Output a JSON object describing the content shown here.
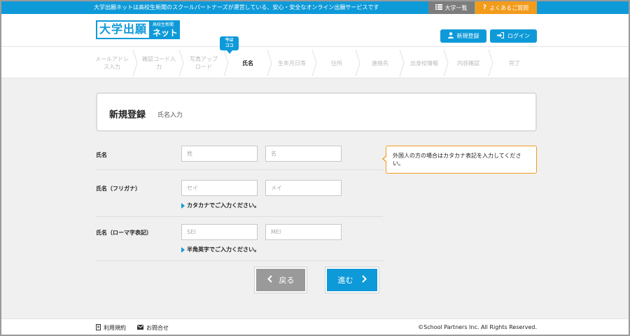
{
  "topbar": {
    "tagline": "大学出願ネットは高校生新聞のスクールパートナーズが運営している、安心・安全なオンライン出願サービスです",
    "univ_list": "大学一覧",
    "faq": "よくあるご質問",
    "faq_icon": "?"
  },
  "header": {
    "logo_main": "大学出願",
    "logo_sub_small": "高校生新聞",
    "logo_sub_large": "ネット",
    "register": "新規登録",
    "login": "ログイン"
  },
  "steps": {
    "now_badge_1": "今は",
    "now_badge_2": "ココ",
    "items": [
      {
        "line1": "メールアドレ",
        "line2": "ス入力"
      },
      {
        "line1": "確認コード入",
        "line2": "力"
      },
      {
        "line1": "写真アップ",
        "line2": "ロード"
      },
      {
        "line1": "氏名",
        "line2": ""
      },
      {
        "line1": "生年月日等",
        "line2": ""
      },
      {
        "line1": "住所",
        "line2": ""
      },
      {
        "line1": "連絡先",
        "line2": ""
      },
      {
        "line1": "出身校情報",
        "line2": ""
      },
      {
        "line1": "内容確認",
        "line2": ""
      },
      {
        "line1": "完了",
        "line2": ""
      }
    ]
  },
  "title": {
    "main": "新規登録",
    "sub": "氏名入力"
  },
  "form": {
    "name": {
      "label": "氏名",
      "last_placeholder": "姓",
      "first_placeholder": "名"
    },
    "kana": {
      "label": "氏名（フリガナ）",
      "last_placeholder": "セイ",
      "first_placeholder": "メイ",
      "hint": "カタカナでご入力ください。"
    },
    "roman": {
      "label": "氏名（ローマ字表記）",
      "last_placeholder": "SEI",
      "first_placeholder": "MEI",
      "hint": "半角英字でご入力ください。"
    },
    "tooltip": "外国人の方の場合はカタカナ表記を入力してください。"
  },
  "buttons": {
    "back": "戻る",
    "next": "進む"
  },
  "footer": {
    "terms": "利用規約",
    "contact": "お問合せ",
    "copyright": "©School Partners Inc. All Rights Reserved."
  },
  "colors": {
    "brand": "#0e9ad9",
    "accent": "#f39b1a",
    "gray_button": "#9a9a9a"
  },
  "icons": [
    "list-icon",
    "question-icon",
    "user-icon",
    "login-icon",
    "chevron-left-icon",
    "chevron-right-icon",
    "document-icon",
    "mail-icon"
  ]
}
